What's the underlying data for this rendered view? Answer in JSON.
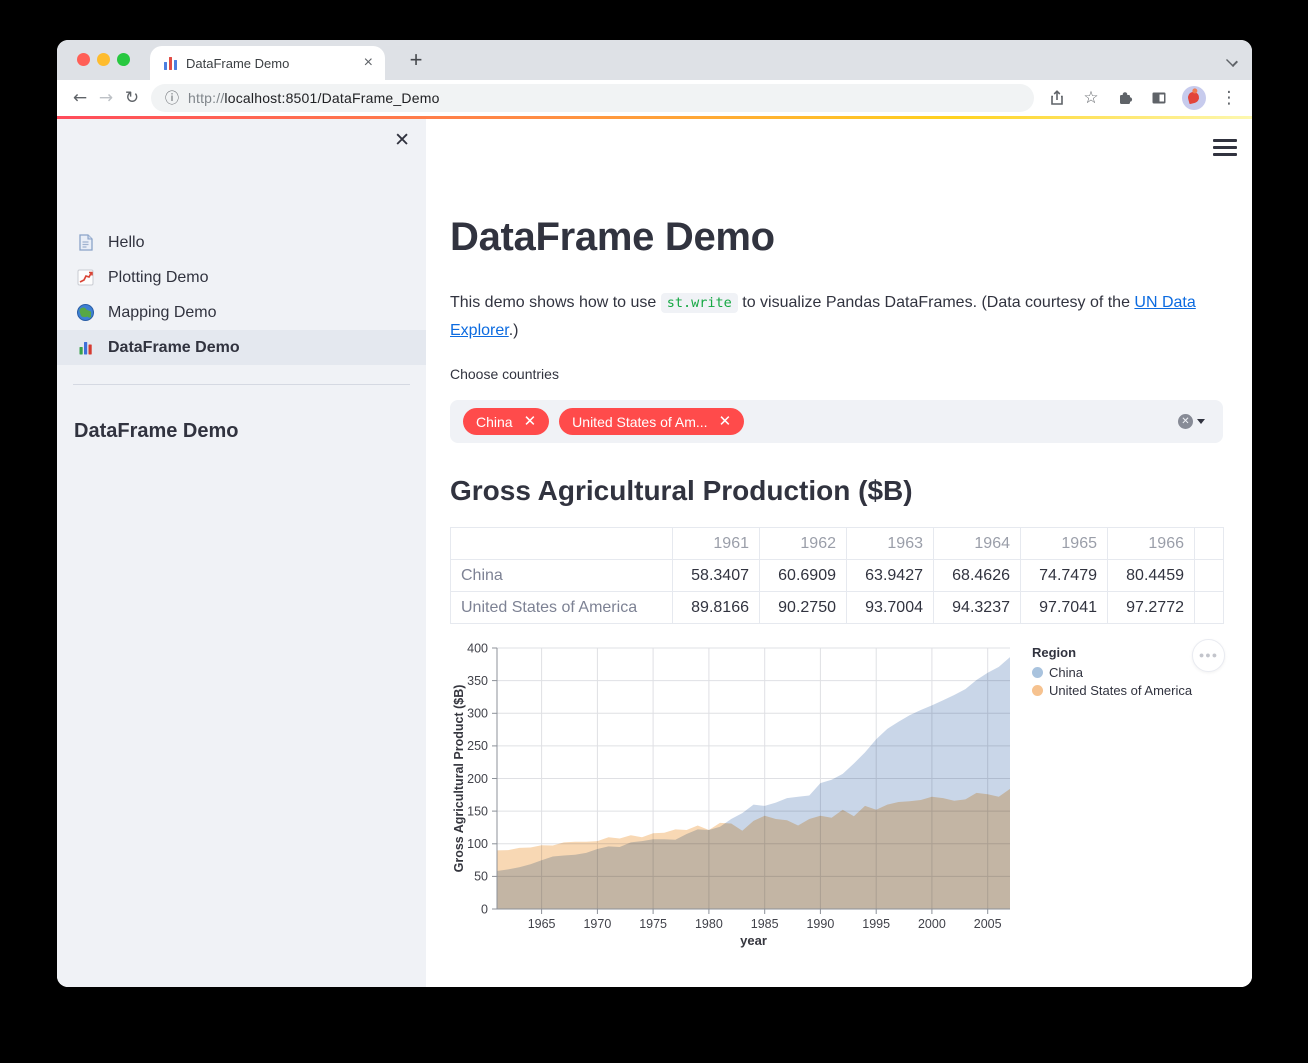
{
  "browser": {
    "tab_title": "DataFrame Demo",
    "url_scheme": "http://",
    "url_rest": "localhost:8501/DataFrame_Demo",
    "new_tab_label": "+",
    "menu_icon": "three-dot-menu"
  },
  "sidebar": {
    "nav_items": [
      {
        "label": "Hello",
        "icon": "document-icon",
        "active": false
      },
      {
        "label": "Plotting Demo",
        "icon": "line-chart-icon",
        "active": false
      },
      {
        "label": "Mapping Demo",
        "icon": "globe-icon",
        "active": false
      },
      {
        "label": "DataFrame Demo",
        "icon": "bar-chart-icon",
        "active": true
      }
    ],
    "section_title": "DataFrame Demo"
  },
  "main": {
    "title": "DataFrame Demo",
    "intro": {
      "before_code": "This demo shows how to use ",
      "code": "st.write",
      "after_code": " to visualize Pandas DataFrames. (Data courtesy of the ",
      "link": "UN Data Explorer",
      "after_link": ".)"
    },
    "multiselect": {
      "label": "Choose countries",
      "selected": [
        "China",
        "United States of Am..."
      ]
    },
    "section_heading": "Gross Agricultural Production ($B)",
    "table": {
      "columns": [
        "",
        "1961",
        "1962",
        "1963",
        "1964",
        "1965",
        "1966"
      ],
      "rows": [
        {
          "label": "China",
          "values": [
            "58.3407",
            "60.6909",
            "63.9427",
            "68.4626",
            "74.7479",
            "80.4459"
          ]
        },
        {
          "label": "United States of America",
          "values": [
            "89.8166",
            "90.2750",
            "93.7004",
            "94.3237",
            "97.7041",
            "97.2772"
          ]
        }
      ]
    }
  },
  "chart_data": {
    "type": "area",
    "xlabel": "year",
    "ylabel": "Gross Agricultural Product ($B)",
    "xlim": [
      1961,
      2007
    ],
    "ylim": [
      0,
      400
    ],
    "grid": true,
    "x_gridlines": [
      1965,
      1970,
      1975,
      1980,
      1985,
      1990,
      1995,
      2000,
      2005
    ],
    "y_ticks": [
      0,
      50,
      100,
      150,
      200,
      250,
      300,
      350,
      400
    ],
    "legend_title": "Region",
    "legend_position": "right",
    "x": [
      1961,
      1962,
      1963,
      1964,
      1965,
      1966,
      1967,
      1968,
      1969,
      1970,
      1971,
      1972,
      1973,
      1974,
      1975,
      1976,
      1977,
      1978,
      1979,
      1980,
      1981,
      1982,
      1983,
      1984,
      1985,
      1986,
      1987,
      1988,
      1989,
      1990,
      1991,
      1992,
      1993,
      1994,
      1995,
      1996,
      1997,
      1998,
      1999,
      2000,
      2001,
      2002,
      2003,
      2004,
      2005,
      2006,
      2007
    ],
    "series": [
      {
        "name": "China",
        "color": "#c9d6e8",
        "legend_color": "#a9c3de",
        "values": [
          58.3,
          60.7,
          63.9,
          68.5,
          74.7,
          80.4,
          82,
          83,
          86,
          92,
          96,
          95,
          102,
          104,
          107,
          107,
          106,
          115,
          122,
          121,
          126,
          138,
          147,
          160,
          158,
          163,
          170,
          172,
          174,
          193,
          198,
          207,
          223,
          240,
          260,
          276,
          287,
          297,
          305,
          312,
          320,
          328,
          337,
          351,
          362,
          371,
          386
        ]
      },
      {
        "name": "United States of America",
        "color": "#f8d8b4",
        "legend_color": "#f6c28f",
        "values": [
          89.8,
          90.3,
          93.7,
          94.3,
          97.7,
          97.3,
          102,
          103,
          103,
          104,
          110,
          108,
          113,
          110,
          116,
          117,
          122,
          121,
          128,
          121,
          132,
          131,
          120,
          135,
          143,
          138,
          136,
          128,
          138,
          143,
          140,
          152,
          142,
          158,
          152,
          160,
          164,
          165,
          167,
          172,
          170,
          166,
          168,
          178,
          176,
          172,
          184
        ]
      }
    ]
  },
  "colors": {
    "accent_red": "#ff4b4b",
    "sidebar_bg": "#f0f2f6",
    "text_dark": "#31333f",
    "link_blue": "#0c6be0",
    "code_green": "#15a843",
    "traffic_red": "#ff5f57",
    "traffic_yellow": "#febc2e",
    "traffic_green": "#28c840"
  }
}
